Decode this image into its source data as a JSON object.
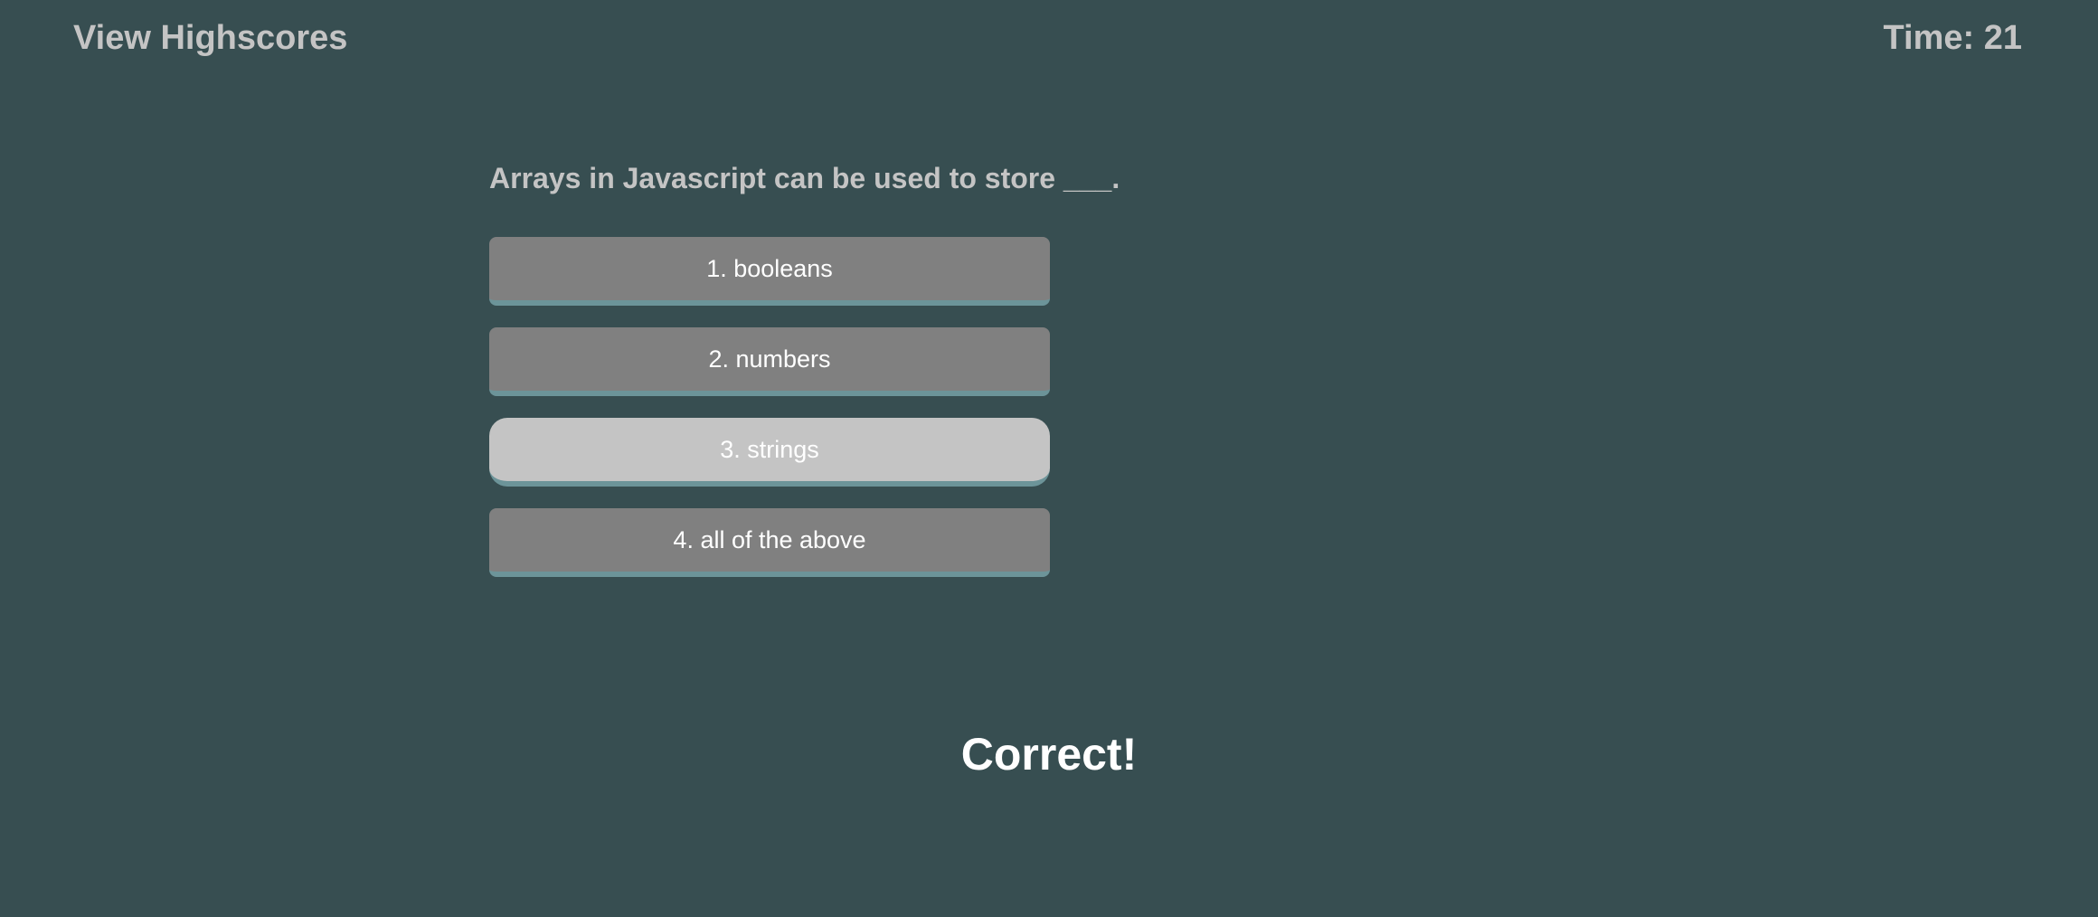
{
  "header": {
    "highscores_label": "View Highscores",
    "timer_label": "Time: 21"
  },
  "quiz": {
    "question": "Arrays in Javascript can be used to store ___.",
    "answers": [
      {
        "label": "1. booleans",
        "selected": false
      },
      {
        "label": "2. numbers",
        "selected": false
      },
      {
        "label": "3. strings",
        "selected": true
      },
      {
        "label": "4. all of the above",
        "selected": false
      }
    ]
  },
  "feedback": {
    "message": "Correct!"
  },
  "colors": {
    "background": "#374e51",
    "header_text": "#c4c4c4",
    "button_default": "#808080",
    "button_selected": "#c4c4c4",
    "button_underline": "#6c9499",
    "button_text": "#ffffff"
  }
}
